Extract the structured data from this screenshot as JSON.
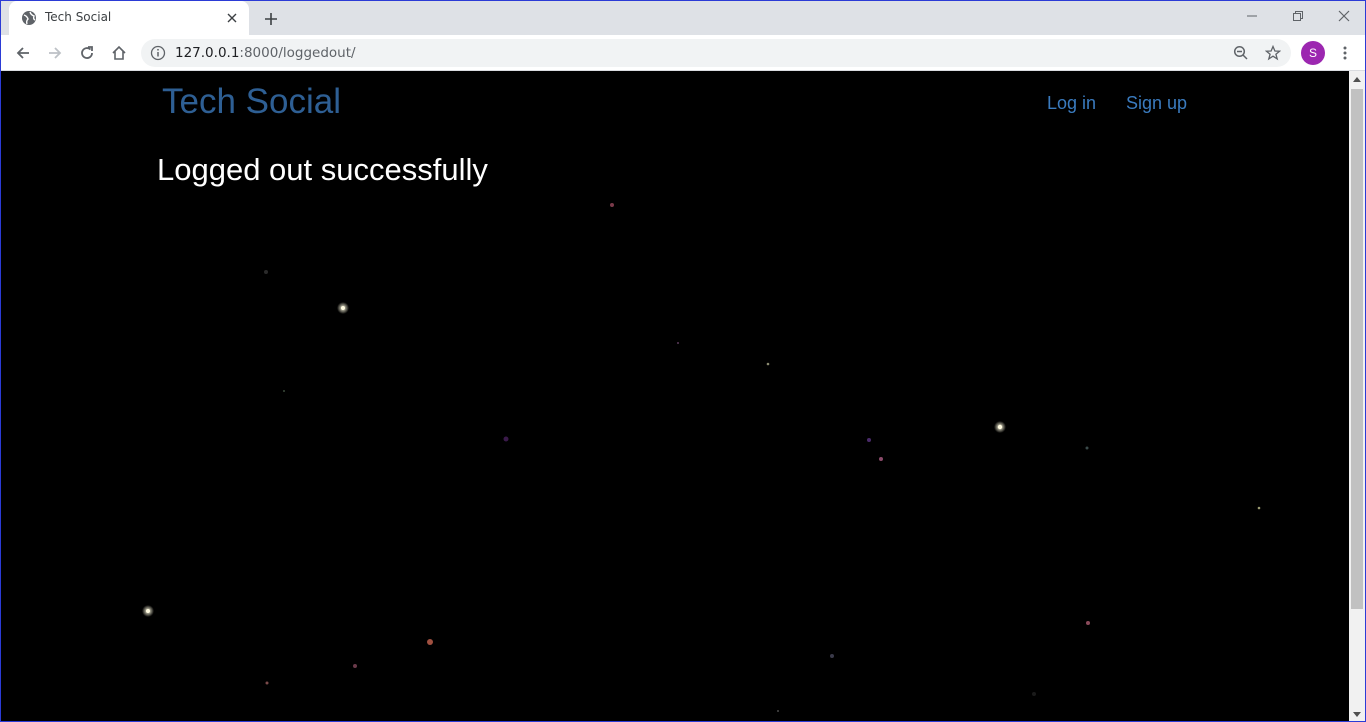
{
  "browser": {
    "tab": {
      "title": "Tech Social",
      "favicon": "globe-icon"
    },
    "new_tab_icon": "plus-icon",
    "window_controls": [
      "minimize-icon",
      "restore-icon",
      "close-icon"
    ],
    "url_host": "127.0.0.1",
    "url_rest": ":8000/loggedout/",
    "profile_initial": "S",
    "profile_color": "#9c27b0"
  },
  "site": {
    "brand": "Tech Social",
    "nav": {
      "login": "Log in",
      "signup": "Sign up"
    },
    "heading": "Logged out successfully",
    "colors": {
      "brand": "#2e5f94",
      "nav": "#3a7bbf",
      "background": "#000000",
      "heading": "#ffffff"
    }
  }
}
